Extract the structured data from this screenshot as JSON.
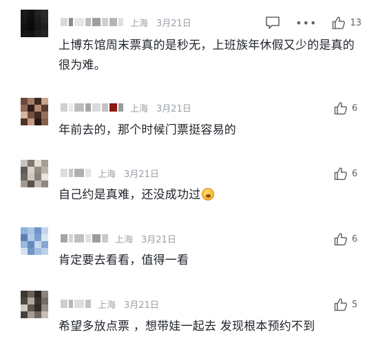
{
  "comments": [
    {
      "location": "上海",
      "date": "3月21日",
      "text": "上博东馆周末票真的是秒无，上班族年休假又少的是真的很为难。",
      "likes": "13",
      "avatar_colors": [
        "#1a1a1a",
        "#111111",
        "#222222",
        "#2b2b2b",
        "#151515",
        "#0d0d0d",
        "#1c1c1c",
        "#262626",
        "#101010",
        "#0a0a0a",
        "#181818",
        "#202020",
        "#161616",
        "#121212",
        "#1e1e1e",
        "#252525"
      ],
      "name_colors": [
        "#d9d9d9",
        "#8a8a8a",
        "#e6e6e6",
        "#bdbdbd",
        "#9e9e9e",
        "#cfcfcf",
        "#b5b5b5",
        "#e0e0e0"
      ]
    },
    {
      "location": "上海",
      "date": "3月21日",
      "text": "年前去的，那个时候门票挺容易的",
      "likes": "6",
      "avatar_colors": [
        "#6b4a3a",
        "#a87c66",
        "#3b2a24",
        "#c9a28d",
        "#8e6752",
        "#2e1f1a",
        "#b48a72",
        "#5a3c30",
        "#d8b3a0",
        "#734f40",
        "#3f2b22",
        "#9a6f59",
        "#4a3429",
        "#c49a83",
        "#261915",
        "#86604c"
      ],
      "name_colors": [
        "#d0d0d0",
        "#e8e8e8",
        "#bcbcbc",
        "#a6a6a6",
        "#dadada",
        "#c2c2c2",
        "#8b1a10",
        "#9a9a9a"
      ]
    },
    {
      "location": "上海",
      "date": "3月21日",
      "text": "自己约是真难，还没成功过",
      "likes": "6",
      "avatar_colors": [
        "#c7c3bd",
        "#7d7770",
        "#e2ddd6",
        "#a59d94",
        "#5f5a55",
        "#d8d2cb",
        "#948c83",
        "#b9b2aa",
        "#6e6861",
        "#cfc9c2",
        "#878079",
        "#e8e3dd",
        "#a39b92",
        "#57524d",
        "#c1bab2",
        "#8f887f"
      ],
      "name_colors": [
        "#dcdcdc",
        "#c6c6c6",
        "#b0b0b0",
        "#e4e4e4"
      ]
    },
    {
      "location": "上海",
      "date": "3月21日",
      "text": "肯定要去看看，值得一看",
      "likes": "6",
      "avatar_colors": [
        "#8fb1d9",
        "#a9c3e4",
        "#6f93c4",
        "#c4d6ec",
        "#5a7fb4",
        "#b3cae6",
        "#7d9fcf",
        "#dbe6f3",
        "#9ab8de",
        "#6489bd",
        "#c9daee",
        "#86a7d3",
        "#d6e2f1",
        "#7297c8",
        "#a1bde0",
        "#bdd0ea"
      ],
      "name_colors": [
        "#a6a6a6",
        "#d4d4d4",
        "#bfbfbf",
        "#e1e1e1",
        "#9c9c9c",
        "#cacaca"
      ]
    },
    {
      "location": "上海",
      "date": "3月21日",
      "text": "希望多放点票 ，想带娃一起去 发现根本预约不到",
      "likes": "5",
      "avatar_colors": [
        "#3d3732",
        "#6a625a",
        "#2a2522",
        "#8c837a",
        "#504842",
        "#b3aba2",
        "#3a342f",
        "#746b62",
        "#d2cbc3",
        "#5e564f",
        "#2f2a26",
        "#968d84",
        "#45403a",
        "#a59c93",
        "#6f675f",
        "#c6bfb7"
      ],
      "name_colors": [
        "#cdcdcd",
        "#b7b7b7",
        "#dedede",
        "#c3c3c3"
      ]
    }
  ],
  "colors": {
    "icon": "#5f6368",
    "meta": "#9aa0a6",
    "text": "#1f2329"
  }
}
